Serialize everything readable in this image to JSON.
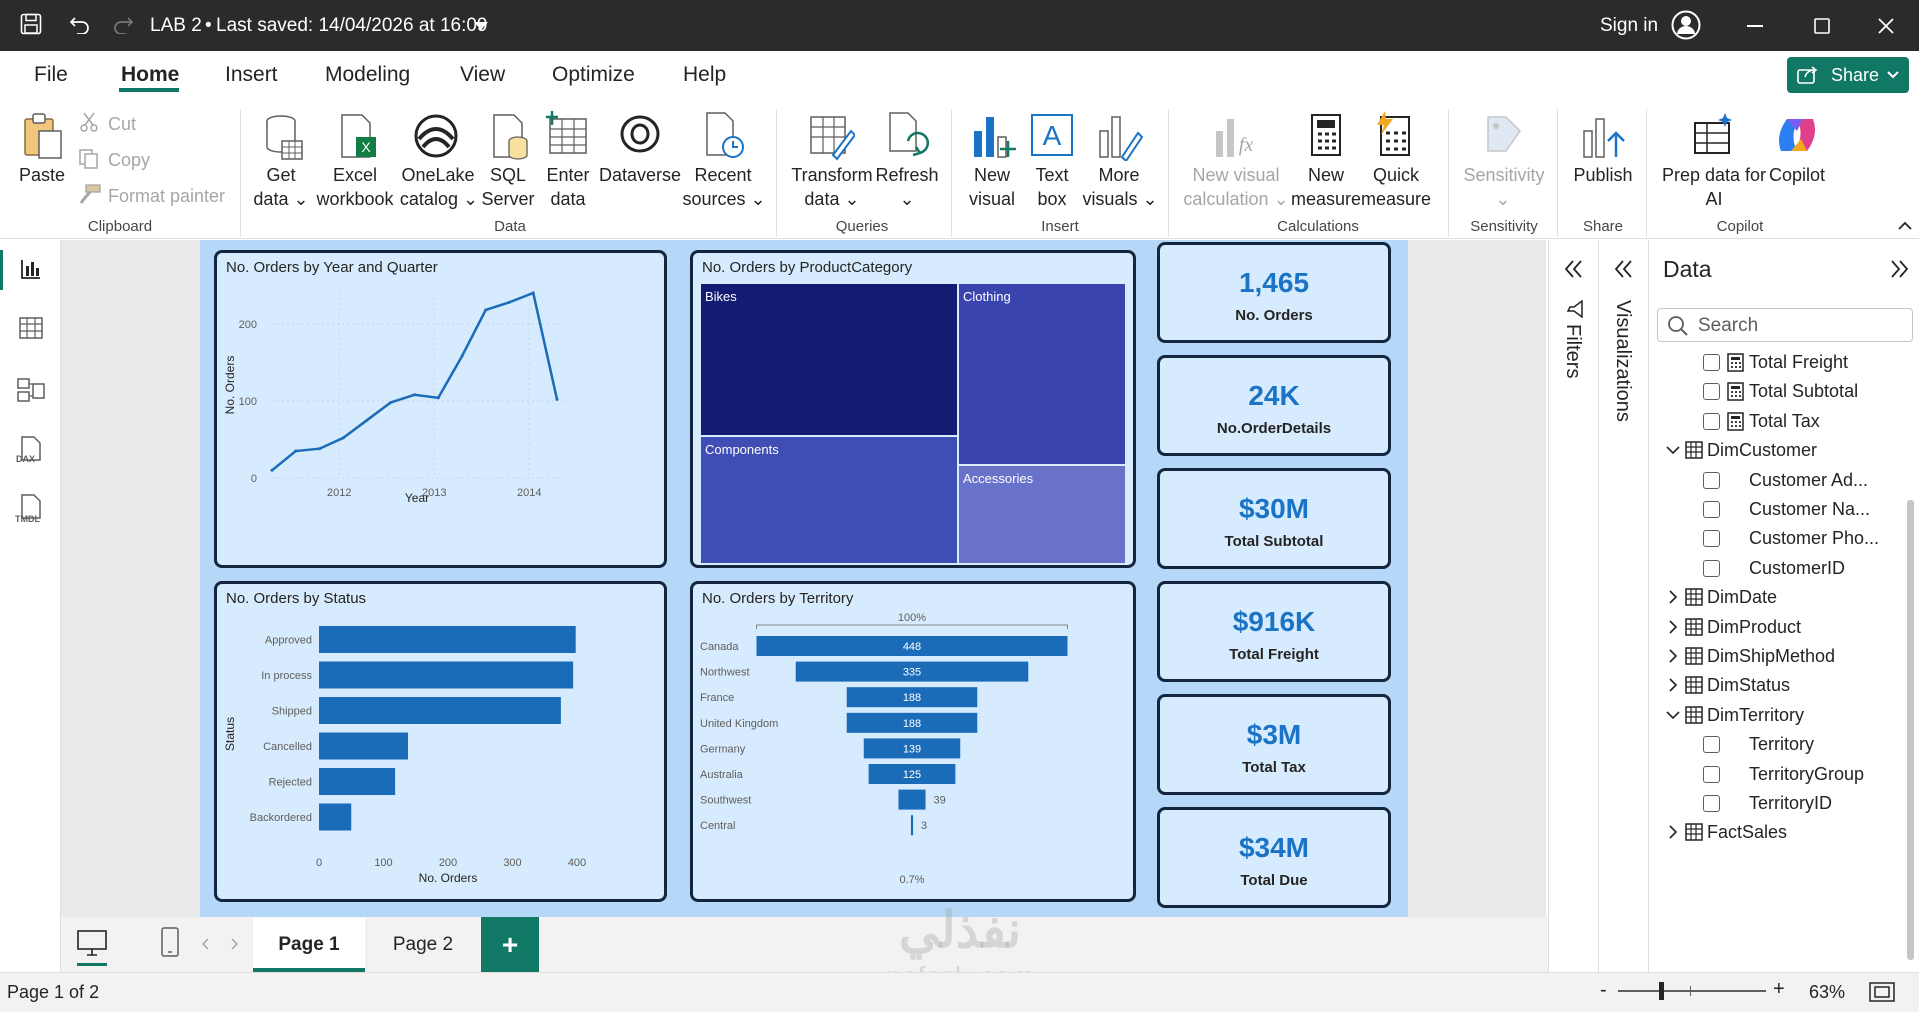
{
  "titlebar": {
    "file_title": "LAB 2",
    "saved_text": "Last saved: 14/04/2026 at 16:09",
    "sign_in": "Sign in"
  },
  "menu": {
    "items": [
      "File",
      "Home",
      "Insert",
      "Modeling",
      "View",
      "Optimize",
      "Help"
    ],
    "active": "Home",
    "share": "Share"
  },
  "ribbon": {
    "paste": "Paste",
    "cut": "Cut",
    "copy": "Copy",
    "format_painter": "Format painter",
    "get_data": [
      "Get",
      "data"
    ],
    "excel": [
      "Excel",
      "workbook"
    ],
    "onelake": [
      "OneLake",
      "catalog"
    ],
    "sql": [
      "SQL",
      "Server"
    ],
    "enter": [
      "Enter",
      "data"
    ],
    "dataverse": "Dataverse",
    "recent": [
      "Recent",
      "sources"
    ],
    "transform": [
      "Transform",
      "data"
    ],
    "refresh": "Refresh",
    "new_visual": [
      "New",
      "visual"
    ],
    "text_box": [
      "Text",
      "box"
    ],
    "more_visuals": [
      "More",
      "visuals"
    ],
    "new_visual_calc": [
      "New visual",
      "calculation"
    ],
    "new_measure": [
      "New",
      "measure"
    ],
    "quick_measure": [
      "Quick",
      "measure"
    ],
    "sensitivity": "Sensitivity",
    "publish": "Publish",
    "prep_data": [
      "Prep data for",
      "AI"
    ],
    "copilot": "Copilot",
    "groups": {
      "clipboard": "Clipboard",
      "data": "Data",
      "queries": "Queries",
      "insert": "Insert",
      "calculations": "Calculations",
      "sensitivity": "Sensitivity",
      "share": "Share",
      "copilot": "Copilot"
    }
  },
  "visuals": {
    "line": {
      "title": "No. Orders by Year and Quarter",
      "xlabel": "Year",
      "ylabel": "No. Orders"
    },
    "treemap": {
      "title": "No. Orders by ProductCategory"
    },
    "status": {
      "title": "No. Orders by Status",
      "xlabel": "No. Orders",
      "ylabel": "Status"
    },
    "territory": {
      "title": "No. Orders by Territory",
      "top_label": "100%",
      "bottom_label": "0.7%"
    }
  },
  "chart_data": [
    {
      "type": "line",
      "title": "No. Orders by Year and Quarter",
      "xlabel": "Year",
      "ylabel": "No. Orders",
      "x_ticks": [
        "2012",
        "2013",
        "2014"
      ],
      "y_ticks": [
        "0",
        "100",
        "200"
      ],
      "ylim": [
        0,
        240
      ],
      "values": [
        10,
        35,
        38,
        52,
        75,
        98,
        108,
        104,
        158,
        218,
        228,
        240,
        102
      ]
    },
    {
      "type": "treemap",
      "title": "No. Orders by ProductCategory",
      "categories": [
        "Bikes",
        "Clothing",
        "Components",
        "Accessories"
      ],
      "colors": [
        "#131b73",
        "#3944ad",
        "#3f4db4",
        "#6872c8"
      ]
    },
    {
      "type": "bar",
      "title": "No. Orders by Status",
      "xlabel": "No. Orders",
      "ylabel": "Status",
      "categories": [
        "Approved",
        "In process",
        "Shipped",
        "Cancelled",
        "Rejected",
        "Backordered"
      ],
      "values": [
        398,
        394,
        375,
        138,
        118,
        50
      ],
      "x_ticks": [
        "0",
        "100",
        "200",
        "300",
        "400"
      ],
      "xlim": [
        0,
        400
      ]
    },
    {
      "type": "funnel",
      "title": "No. Orders by Territory",
      "categories": [
        "Canada",
        "Northwest",
        "France",
        "United Kingdom",
        "Germany",
        "Australia",
        "Southwest",
        "Central"
      ],
      "values": [
        448,
        335,
        188,
        188,
        139,
        125,
        39,
        3
      ]
    }
  ],
  "cards": [
    {
      "value": "1,465",
      "label": "No. Orders"
    },
    {
      "value": "24K",
      "label": "No.OrderDetails"
    },
    {
      "value": "$30M",
      "label": "Total Subtotal"
    },
    {
      "value": "$916K",
      "label": "Total Freight"
    },
    {
      "value": "$3M",
      "label": "Total Tax"
    },
    {
      "value": "$34M",
      "label": "Total Due"
    }
  ],
  "panes": {
    "filters": "Filters",
    "visualizations": "Visualizations",
    "data_title": "Data",
    "search_placeholder": "Search"
  },
  "data_fields": [
    {
      "name": "Total Freight",
      "kind": "measure"
    },
    {
      "name": "Total Subtotal",
      "kind": "measure"
    },
    {
      "name": "Total Tax",
      "kind": "measure"
    },
    {
      "name": "DimCustomer",
      "kind": "table-open"
    },
    {
      "name": "Customer Ad...",
      "kind": "field"
    },
    {
      "name": "Customer Na...",
      "kind": "field"
    },
    {
      "name": "Customer Pho...",
      "kind": "field"
    },
    {
      "name": "CustomerID",
      "kind": "field"
    },
    {
      "name": "DimDate",
      "kind": "table"
    },
    {
      "name": "DimProduct",
      "kind": "table"
    },
    {
      "name": "DimShipMethod",
      "kind": "table"
    },
    {
      "name": "DimStatus",
      "kind": "table"
    },
    {
      "name": "DimTerritory",
      "kind": "table-open"
    },
    {
      "name": "Territory",
      "kind": "field"
    },
    {
      "name": "TerritoryGroup",
      "kind": "field"
    },
    {
      "name": "TerritoryID",
      "kind": "field"
    },
    {
      "name": "FactSales",
      "kind": "table"
    }
  ],
  "pages": {
    "tabs": [
      "Page 1",
      "Page 2"
    ],
    "active": "Page 1",
    "add": "+"
  },
  "status": {
    "page_info": "Page 1 of 2",
    "zoom": "63%",
    "watermark_ar": "نفذلي",
    "watermark_en": "nofezly.com"
  }
}
